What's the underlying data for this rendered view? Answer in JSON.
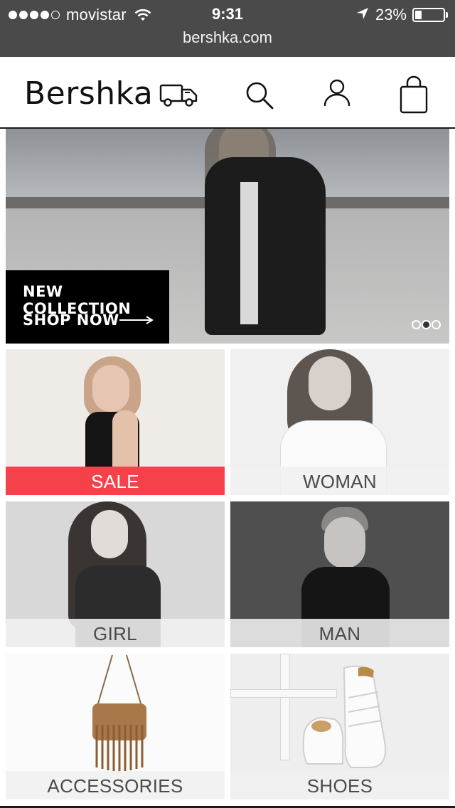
{
  "status_bar": {
    "carrier": "movistar",
    "time": "9:31",
    "battery": "23%",
    "battery_level": 0.23,
    "signal_bars": 4,
    "signal_total": 5
  },
  "browser": {
    "url": "bershka.com"
  },
  "header": {
    "logo": "Bershka",
    "icons": [
      "truck-icon",
      "search-icon",
      "user-icon",
      "shopping-bag-icon"
    ]
  },
  "hero": {
    "line1": "NEW COLLECTION",
    "line2": "SHOP NOW",
    "slide_count": 3,
    "active_slide": 2
  },
  "categories": [
    {
      "label": "SALE"
    },
    {
      "label": "WOMAN"
    },
    {
      "label": "GIRL"
    },
    {
      "label": "MAN"
    },
    {
      "label": "ACCESSORIES"
    },
    {
      "label": "SHOES"
    }
  ],
  "colors": {
    "status_bg": "#4a4a4a",
    "sale_accent": "#f5414a",
    "label_text": "#4a4a4a"
  }
}
